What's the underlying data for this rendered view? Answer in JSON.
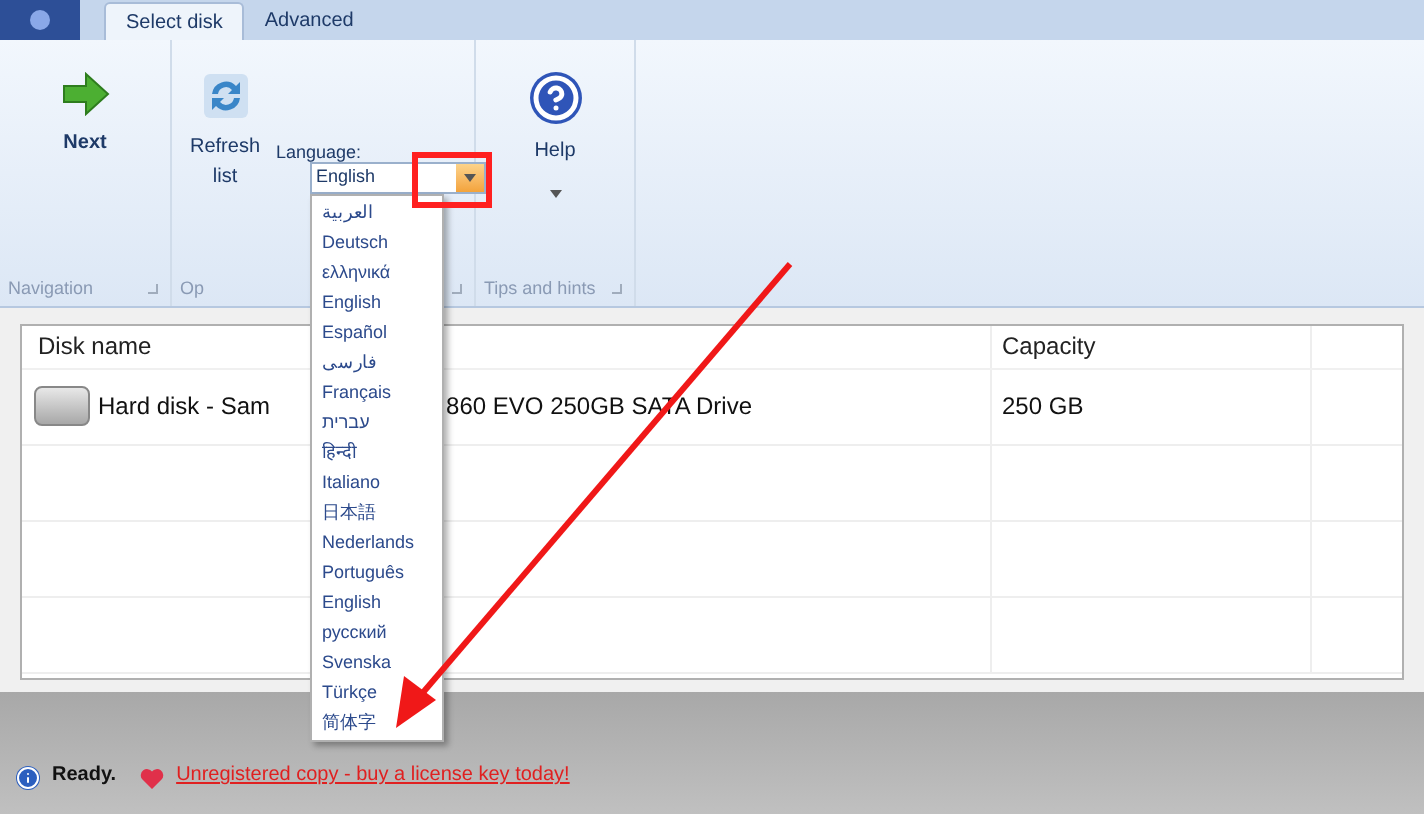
{
  "tabs": [
    {
      "label": "Select disk",
      "selected": true
    },
    {
      "label": "Advanced",
      "selected": false
    }
  ],
  "ribbon": {
    "groups": [
      {
        "label": "Navigation",
        "buttons": [
          {
            "label": "Next",
            "kind": "next",
            "has_dropdown": false
          }
        ]
      },
      {
        "label": "Op",
        "buttons": [
          {
            "label": "Refresh list",
            "kind": "refresh",
            "has_dropdown": false
          }
        ],
        "language": {
          "label": "Language:",
          "value": "English",
          "expanded": true
        }
      },
      {
        "label": "Tips and hints",
        "buttons": [
          {
            "label": "Help",
            "kind": "help",
            "has_dropdown": true
          }
        ]
      }
    ]
  },
  "language_options": [
    {
      "label": "العربية",
      "selected": false
    },
    {
      "label": "Deutsch",
      "selected": false
    },
    {
      "label": "ελληνικά",
      "selected": false
    },
    {
      "label": "English",
      "selected": false
    },
    {
      "label": "Español",
      "selected": false
    },
    {
      "label": "فارسی",
      "selected": false
    },
    {
      "label": "Français",
      "selected": false
    },
    {
      "label": "עברית",
      "selected": false
    },
    {
      "label": "हिन्दी",
      "selected": false
    },
    {
      "label": "Italiano",
      "selected": false
    },
    {
      "label": "日本語",
      "selected": false
    },
    {
      "label": "Nederlands",
      "selected": false
    },
    {
      "label": "Português",
      "selected": false
    },
    {
      "label": "English",
      "selected": false
    },
    {
      "label": "русский",
      "selected": false
    },
    {
      "label": "Svenska",
      "selected": false
    },
    {
      "label": "Türkçe",
      "selected": false
    },
    {
      "label": "简体字",
      "selected": false
    }
  ],
  "table": {
    "columns": [
      "Disk name",
      "Capacity"
    ],
    "rows": [
      {
        "disk_name_start": "Hard disk - Sam",
        "disk_name_end": "860 EVO 250GB SATA Drive",
        "capacity": "250 GB"
      }
    ]
  },
  "status_bar": {
    "status": "Ready.",
    "link": "Unregistered copy - buy a license key today!"
  }
}
